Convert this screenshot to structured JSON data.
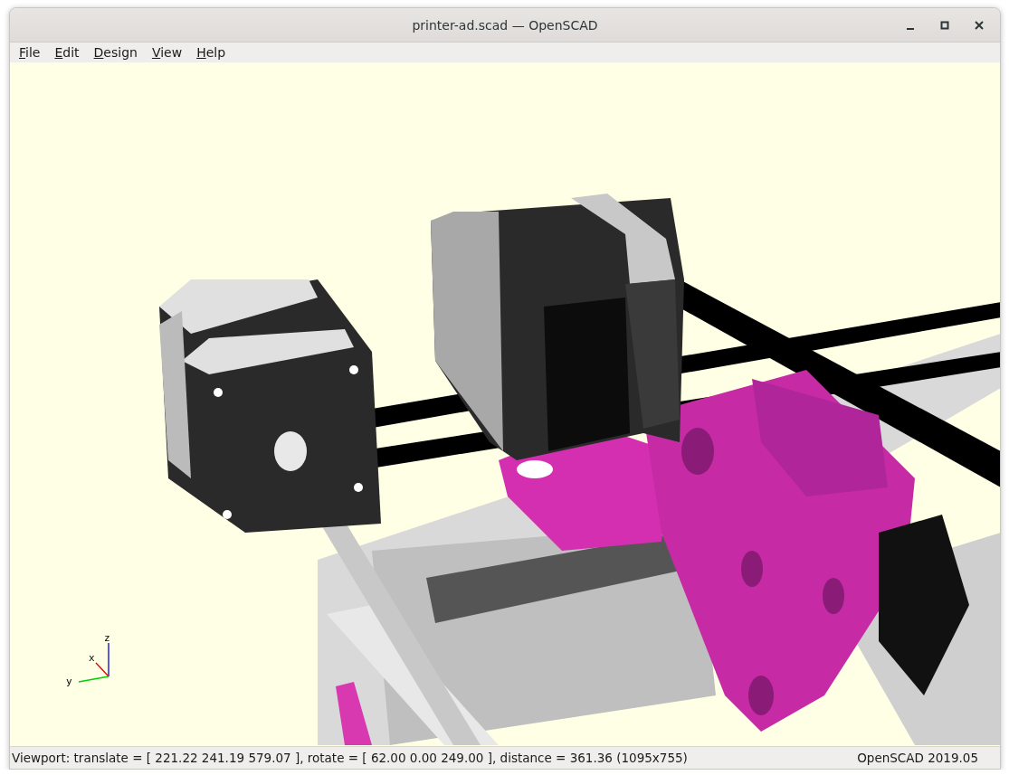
{
  "window": {
    "title": "printer-ad.scad — OpenSCAD"
  },
  "menu": [
    {
      "label": "File"
    },
    {
      "label": "Edit"
    },
    {
      "label": "Design"
    },
    {
      "label": "View"
    },
    {
      "label": "Help"
    }
  ],
  "viewport": {
    "axes": {
      "x": "x",
      "y": "y",
      "z": "z"
    }
  },
  "status_bar": {
    "viewport": "Viewport: translate = [ 221.22 241.19 579.07 ], rotate = [ 62.00 0.00 249.00 ], distance = 361.36 (1095x755)",
    "version": "OpenSCAD 2019.05"
  }
}
